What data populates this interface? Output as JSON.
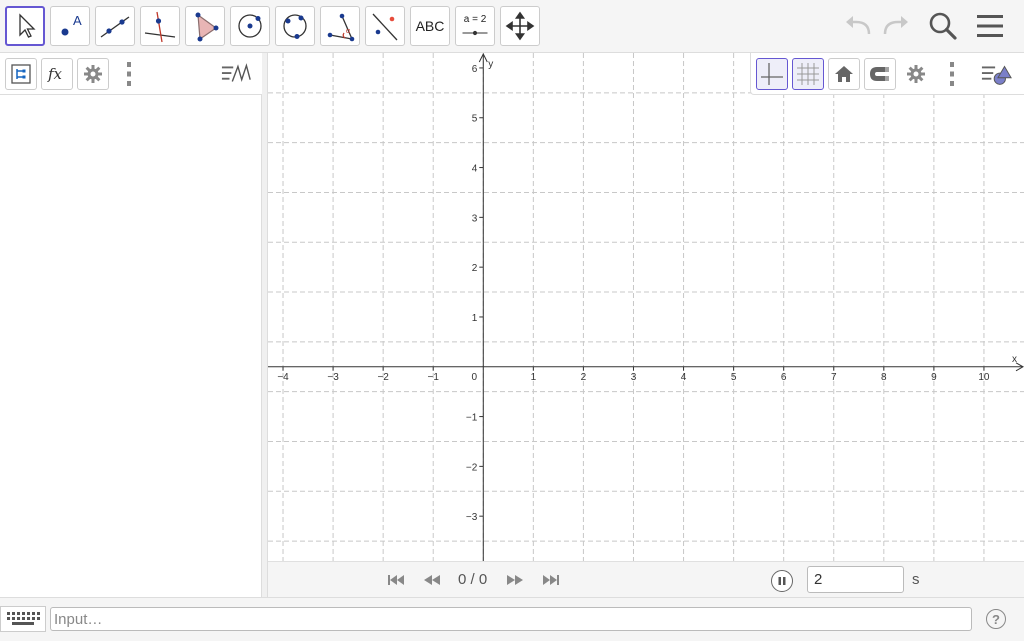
{
  "toolbar": {
    "tools": [
      {
        "name": "move-tool",
        "label": ""
      },
      {
        "name": "point-tool",
        "label": ""
      },
      {
        "name": "line-tool",
        "label": ""
      },
      {
        "name": "perpendicular-line-tool",
        "label": ""
      },
      {
        "name": "polygon-tool",
        "label": ""
      },
      {
        "name": "circle-center-point-tool",
        "label": ""
      },
      {
        "name": "circle-through-points-tool",
        "label": ""
      },
      {
        "name": "angle-tool",
        "label": ""
      },
      {
        "name": "reflect-tool",
        "label": ""
      },
      {
        "name": "text-tool",
        "label": "ABC"
      },
      {
        "name": "slider-tool",
        "label": "a = 2"
      },
      {
        "name": "move-graphics-view-tool",
        "label": ""
      }
    ],
    "selected_tool": "move-tool"
  },
  "algebra": {
    "header_buttons": [
      "algebra-view-icon",
      "function-icon",
      "gear-icon",
      "more-vertical-icon",
      "algebra-style-icon"
    ]
  },
  "graphics": {
    "x_axis_label": "x",
    "y_axis_label": "y",
    "x_ticks": [
      "−4",
      "−3",
      "−2",
      "−1",
      "0",
      "1",
      "2",
      "3",
      "4",
      "5",
      "6",
      "7",
      "8",
      "9",
      "10"
    ],
    "y_ticks": [
      "6",
      "5",
      "4",
      "3",
      "2",
      "1",
      "−1",
      "−2",
      "−3"
    ],
    "xlim": [
      -4.3,
      10.8
    ],
    "ylim": [
      -3.9,
      6.3
    ],
    "grid": true,
    "axis_color": "#333333",
    "grid_color": "#c8c8c8"
  },
  "style_bar": {
    "buttons": [
      "axes-icon",
      "grid-icon",
      "home-icon",
      "magnet-icon",
      "gear-icon",
      "more-vertical-icon",
      "graphics-style-icon"
    ]
  },
  "animation": {
    "frame_label": "0 / 0",
    "speed_value": "2",
    "speed_unit": "s"
  },
  "input_bar": {
    "placeholder": "Input…",
    "help_label": "?"
  },
  "colors": {
    "accent": "#6557d2",
    "point_blue": "#1565c0",
    "tool_red": "#c0392b"
  }
}
